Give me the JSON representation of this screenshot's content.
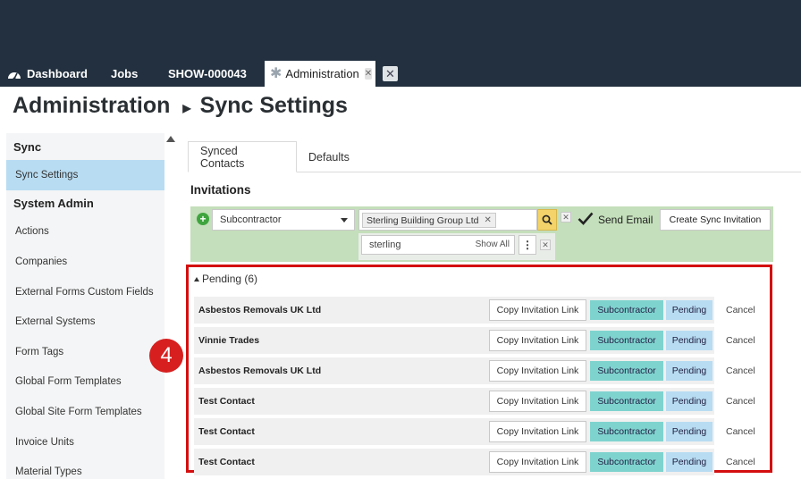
{
  "tabs": {
    "dashboard": "Dashboard",
    "jobs": "Jobs",
    "show": "SHOW-000043",
    "admin": "Administration"
  },
  "page_title": {
    "section": "Administration",
    "page": "Sync Settings"
  },
  "sidebar": {
    "groups": [
      {
        "heading": "Sync",
        "items": [
          {
            "label": "Sync Settings",
            "active": true
          }
        ]
      },
      {
        "heading": "System Admin",
        "items": [
          {
            "label": "Actions"
          },
          {
            "label": "Companies"
          },
          {
            "label": "External Forms Custom Fields"
          },
          {
            "label": "External Systems"
          },
          {
            "label": "Form Tags"
          },
          {
            "label": "Global Form Templates"
          },
          {
            "label": "Global Site Form Templates"
          },
          {
            "label": "Invoice Units"
          },
          {
            "label": "Material Types"
          }
        ]
      }
    ]
  },
  "badge": "4",
  "main_tabs": {
    "synced_contacts": "Synced Contacts",
    "defaults": "Defaults"
  },
  "invitations": {
    "title": "Invitations",
    "type_select": "Subcontractor",
    "company_chip": "Sterling Building Group Ltd",
    "search_value": "sterling",
    "show_all": "Show All",
    "send_email_label": "Send Email",
    "send_email_checked": true,
    "create_button": "Create Sync Invitation"
  },
  "pending": {
    "heading": "Pending (6)",
    "rows": [
      {
        "name": "Asbestos Removals UK Ltd",
        "copy": "Copy Invitation Link",
        "role": "Subcontractor",
        "status": "Pending",
        "cancel": "Cancel"
      },
      {
        "name": "Vinnie Trades",
        "copy": "Copy Invitation Link",
        "role": "Subcontractor",
        "status": "Pending",
        "cancel": "Cancel"
      },
      {
        "name": "Asbestos Removals UK Ltd",
        "copy": "Copy Invitation Link",
        "role": "Subcontractor",
        "status": "Pending",
        "cancel": "Cancel"
      },
      {
        "name": "Test Contact",
        "copy": "Copy Invitation Link",
        "role": "Subcontractor",
        "status": "Pending",
        "cancel": "Cancel"
      },
      {
        "name": "Test Contact",
        "copy": "Copy Invitation Link",
        "role": "Subcontractor",
        "status": "Pending",
        "cancel": "Cancel"
      },
      {
        "name": "Test Contact",
        "copy": "Copy Invitation Link",
        "role": "Subcontractor",
        "status": "Pending",
        "cancel": "Cancel"
      }
    ]
  },
  "colors": {
    "topbar": "#22303f",
    "highlight_border": "#d40f0f",
    "role_tag": "#7fd3cf",
    "status_tag": "#b8dcf2",
    "filter_panel": "#c4dfbb"
  }
}
